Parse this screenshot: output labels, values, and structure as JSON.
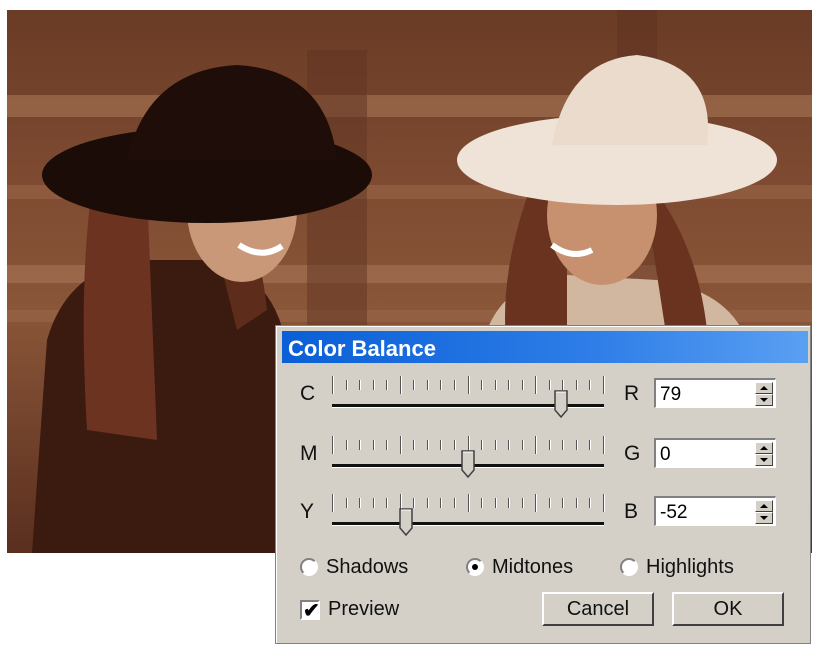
{
  "dialog": {
    "title": "Color Balance",
    "sliders": [
      {
        "left_label": "C",
        "right_label": "R",
        "value": "79",
        "position": 0.86
      },
      {
        "left_label": "M",
        "right_label": "G",
        "value": "0",
        "position": 0.5
      },
      {
        "left_label": "Y",
        "right_label": "B",
        "value": "-52",
        "position": 0.26
      }
    ],
    "tone_options": [
      {
        "label": "Shadows",
        "selected": false
      },
      {
        "label": "Midtones",
        "selected": true
      },
      {
        "label": "Highlights",
        "selected": false
      }
    ],
    "preview": {
      "label": "Preview",
      "checked": true,
      "mark": "✔"
    },
    "cancel_label": "Cancel",
    "ok_label": "OK"
  },
  "colors": {
    "title_bar": "#0a5fd6",
    "dialog_bg": "#d4d0c8",
    "sepia": "#7d4a31"
  },
  "icons": [
    "spin-up-arrow-icon",
    "spin-down-arrow-icon",
    "slider-thumb-icon",
    "checkmark-icon"
  ]
}
